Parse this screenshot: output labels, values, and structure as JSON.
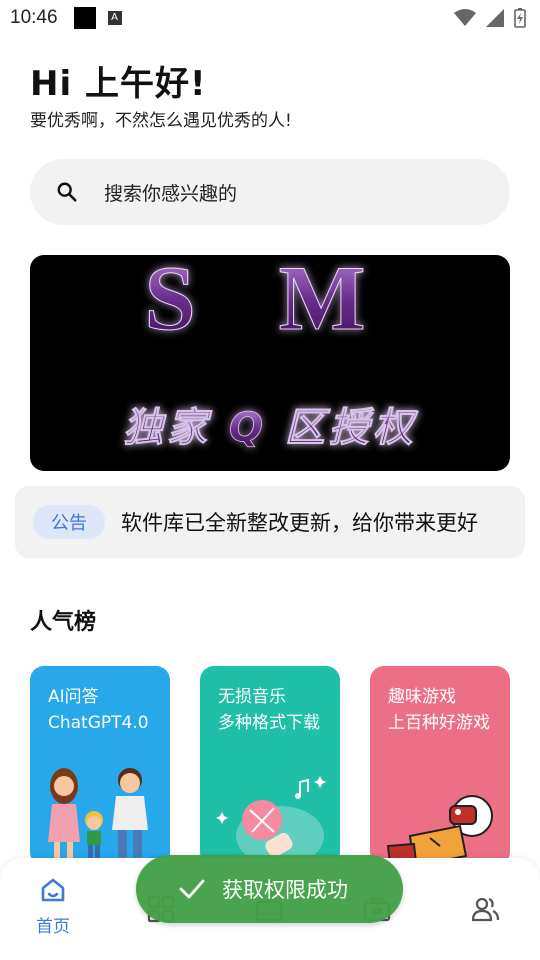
{
  "status_bar": {
    "time": "10:46",
    "indicator_a": "A",
    "icons": [
      "wifi-icon",
      "signal-icon",
      "battery-charging-icon"
    ]
  },
  "header": {
    "greeting": "Hi 上午好!",
    "subtitle": "要优秀啊，不然怎么遇见优秀的人!"
  },
  "search": {
    "placeholder": "搜索你感兴趣的"
  },
  "banner": {
    "line1": "S M",
    "line2": "独家 Q 区授权"
  },
  "notice": {
    "tag": "公告",
    "message": "软件库已全新整改更新，给你带来更好"
  },
  "popular": {
    "title": "人气榜",
    "cards": [
      {
        "title": "AI问答\nChatGPT4.0",
        "color": "#26a8ea"
      },
      {
        "title": "无损音乐\n多种格式下载",
        "color": "#1fbfa8"
      },
      {
        "title": "趣味游戏\n上百种好游戏",
        "color": "#ec6f86"
      }
    ]
  },
  "bottom_nav": {
    "items": [
      {
        "label": "首页",
        "icon": "home-icon",
        "active": true
      },
      {
        "label": "",
        "icon": "grid-icon",
        "active": false
      },
      {
        "label": "",
        "icon": "media-icon",
        "active": false
      },
      {
        "label": "",
        "icon": "toolbox-icon",
        "active": false
      },
      {
        "label": "",
        "icon": "users-icon",
        "active": false
      }
    ]
  },
  "toast": {
    "text": "获取权限成功",
    "icon": "check-icon"
  },
  "colors": {
    "accent": "#3f78d6",
    "toast": "#43a047"
  }
}
